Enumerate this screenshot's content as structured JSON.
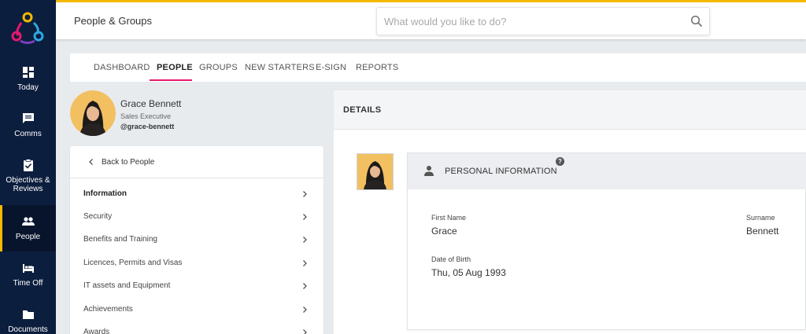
{
  "nav": {
    "items": [
      {
        "label": "Today",
        "icon": "dashboard-icon"
      },
      {
        "label": "Comms",
        "icon": "chat-icon"
      },
      {
        "label": "Objectives & Reviews",
        "icon": "clipboard-check-icon"
      },
      {
        "label": "People",
        "icon": "people-icon"
      },
      {
        "label": "Time Off",
        "icon": "bed-icon"
      },
      {
        "label": "Documents",
        "icon": "folder-icon"
      }
    ],
    "active": "People"
  },
  "header": {
    "title": "People & Groups",
    "search_placeholder": "What would you like to do?"
  },
  "tabs": [
    {
      "label": "DASHBOARD"
    },
    {
      "label": "PEOPLE",
      "active": true
    },
    {
      "label": "GROUPS"
    },
    {
      "label": "NEW STARTERS"
    },
    {
      "label": "E-SIGN"
    },
    {
      "label": "REPORTS"
    }
  ],
  "profile": {
    "name": "Grace Bennett",
    "role": "Sales Executive",
    "handle": "@grace-bennett"
  },
  "side_menu": {
    "back_label": "Back to People",
    "items": [
      {
        "label": "Information",
        "active": true
      },
      {
        "label": "Security"
      },
      {
        "label": "Benefits and Training"
      },
      {
        "label": "Licences, Permits and Visas"
      },
      {
        "label": "IT assets and Equipment"
      },
      {
        "label": "Achievements"
      },
      {
        "label": "Awards"
      }
    ]
  },
  "details": {
    "title": "DETAILS",
    "section_title": "PERSONAL INFORMATION",
    "help_glyph": "?",
    "fields": {
      "first_name_label": "First Name",
      "first_name_value": "Grace",
      "surname_label": "Surname",
      "surname_value": "Bennett",
      "dob_label": "Date of Birth",
      "dob_value": "Thu, 05 Aug 1993"
    }
  },
  "colors": {
    "nav_bg": "#0c1e3e",
    "accent_yellow": "#f5b800",
    "accent_pink": "#e6186d",
    "avatar_bg": "#f2c060"
  }
}
